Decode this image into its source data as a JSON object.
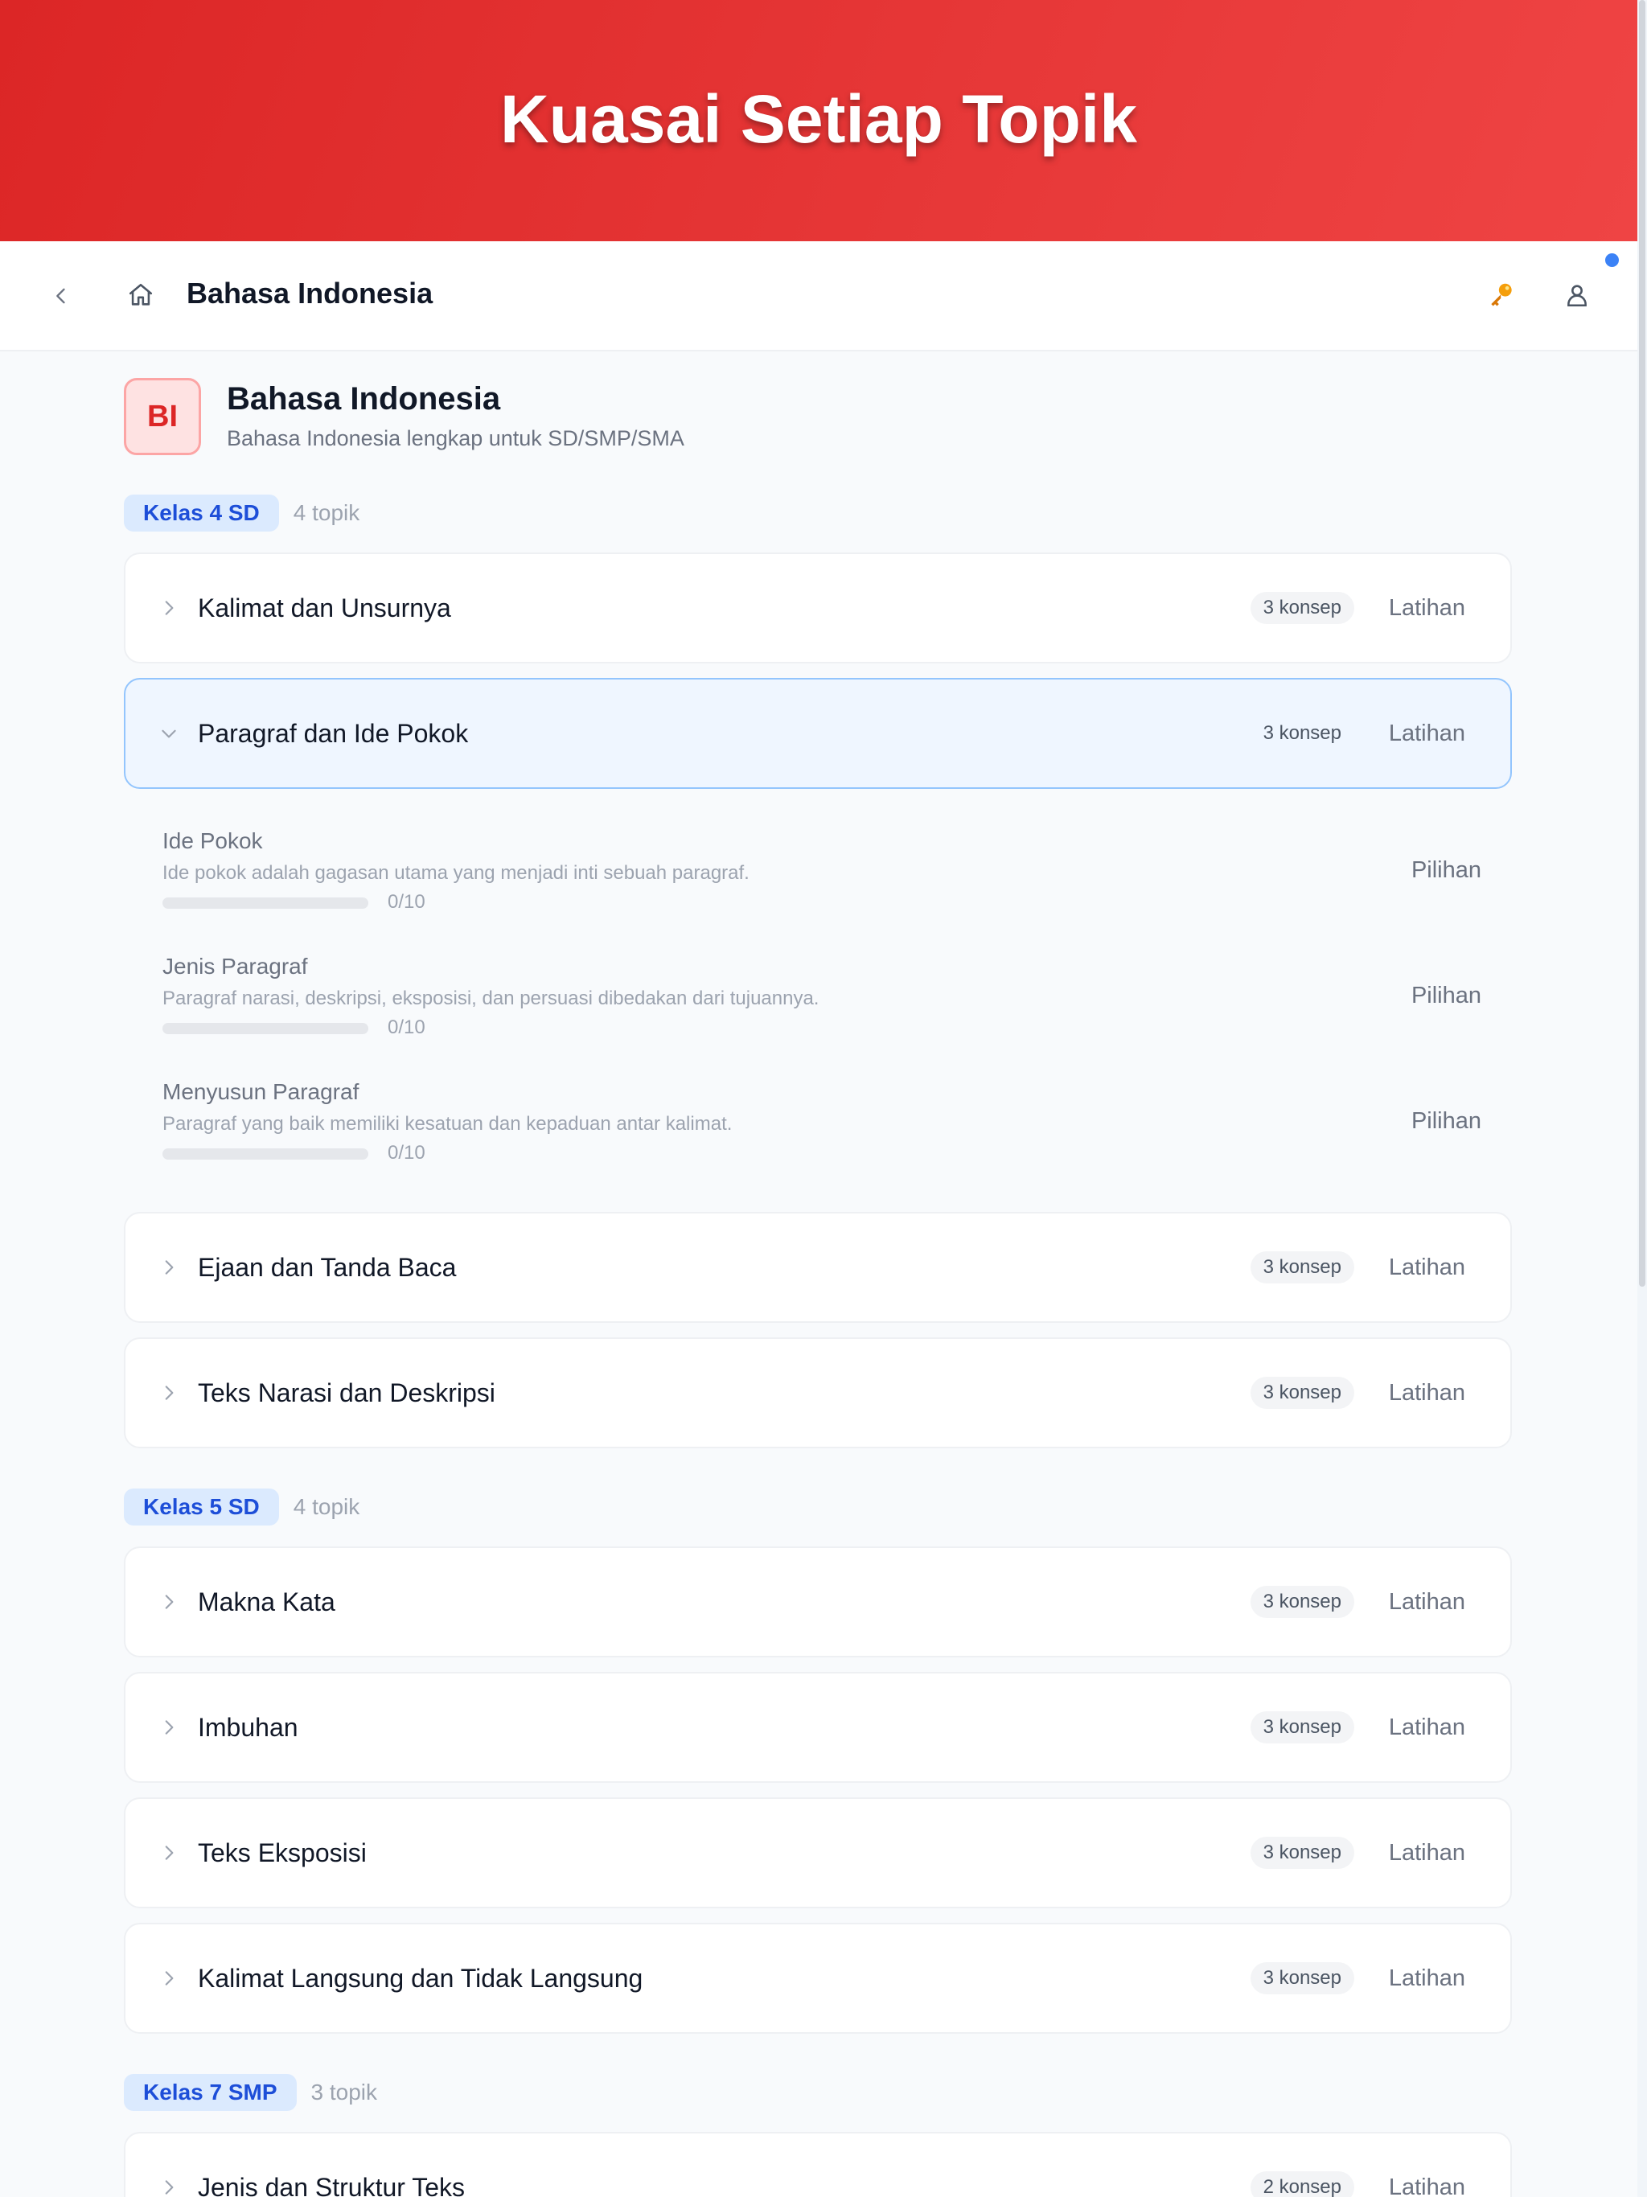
{
  "banner": {
    "title": "Kuasai Setiap Topik"
  },
  "topbar": {
    "title": "Bahasa Indonesia",
    "back_icon": "chevron-left-icon",
    "home_icon": "home-icon",
    "key_icon": "key-icon",
    "user_icon": "user-icon"
  },
  "subject": {
    "initials": "BI",
    "name": "Bahasa Indonesia",
    "description": "Bahasa Indonesia lengkap untuk SD/SMP/SMA"
  },
  "grades": [
    {
      "label": "Kelas 4 SD",
      "count": "4 topik",
      "topics": [
        {
          "name": "Kalimat dan Unsurnya",
          "konsep": "3 konsep",
          "action": "Latihan",
          "expanded": false
        },
        {
          "name": "Paragraf dan Ide Pokok",
          "konsep": "3 konsep",
          "action": "Latihan",
          "expanded": true,
          "concepts": [
            {
              "name": "Ide Pokok",
              "desc": "Ide pokok adalah gagasan utama yang menjadi inti sebuah paragraf.",
              "progress_text": "0/10",
              "progress": 0,
              "action": "Pilihan"
            },
            {
              "name": "Jenis Paragraf",
              "desc": "Paragraf narasi, deskripsi, eksposisi, dan persuasi dibedakan dari tujuannya.",
              "progress_text": "0/10",
              "progress": 0,
              "action": "Pilihan"
            },
            {
              "name": "Menyusun Paragraf",
              "desc": "Paragraf yang baik memiliki kesatuan dan kepaduan antar kalimat.",
              "progress_text": "0/10",
              "progress": 0,
              "action": "Pilihan"
            }
          ]
        },
        {
          "name": "Ejaan dan Tanda Baca",
          "konsep": "3 konsep",
          "action": "Latihan",
          "expanded": false
        },
        {
          "name": "Teks Narasi dan Deskripsi",
          "konsep": "3 konsep",
          "action": "Latihan",
          "expanded": false
        }
      ]
    },
    {
      "label": "Kelas 5 SD",
      "count": "4 topik",
      "topics": [
        {
          "name": "Makna Kata",
          "konsep": "3 konsep",
          "action": "Latihan",
          "expanded": false
        },
        {
          "name": "Imbuhan",
          "konsep": "3 konsep",
          "action": "Latihan",
          "expanded": false
        },
        {
          "name": "Teks Eksposisi",
          "konsep": "3 konsep",
          "action": "Latihan",
          "expanded": false
        },
        {
          "name": "Kalimat Langsung dan Tidak Langsung",
          "konsep": "3 konsep",
          "action": "Latihan",
          "expanded": false
        }
      ]
    },
    {
      "label": "Kelas 7 SMP",
      "count": "3 topik",
      "topics": [
        {
          "name": "Jenis dan Struktur Teks",
          "konsep": "2 konsep",
          "action": "Latihan",
          "expanded": false
        }
      ]
    }
  ],
  "colors": {
    "banner": "#dc2626",
    "accent": "#3b82f6",
    "grade_badge_bg": "#dbeafe",
    "grade_badge_text": "#1d4ed8"
  }
}
